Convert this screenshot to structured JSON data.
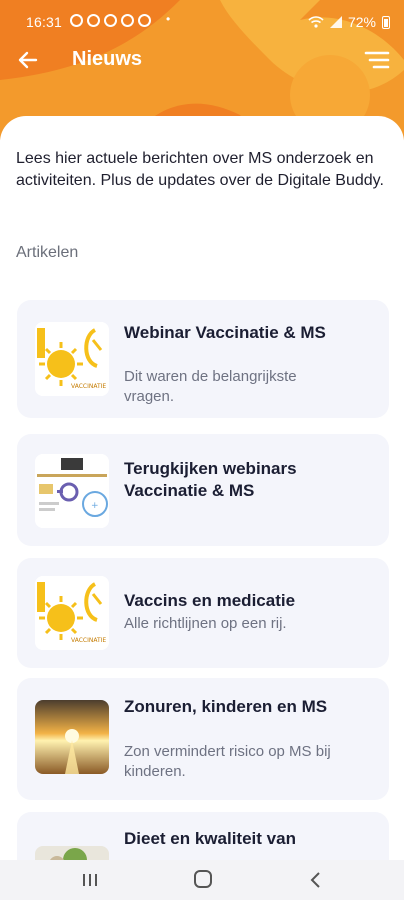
{
  "status_bar": {
    "time": "16:31",
    "battery": "72%"
  },
  "header": {
    "title": "Nieuws"
  },
  "intro_text": "Lees hier actuele berichten over MS onderzoek en activiteiten. Plus de updates over de Digitale Buddy.",
  "section_label": "Artikelen",
  "articles": [
    {
      "title": "Webinar Vaccinatie & MS",
      "subtitle": "Dit waren de belangrijkste vragen.",
      "thumb_text": "VACCINATIE"
    },
    {
      "title": "Terugkijken webinars Vaccinatie & MS",
      "subtitle": ""
    },
    {
      "title": "Vaccins en medicatie",
      "subtitle": "Alle richtlijnen op een rij.",
      "thumb_text": "VACCINATIE"
    },
    {
      "title": "Zonuren, kinderen en MS",
      "subtitle": "Zon vermindert risico op MS bij kinderen."
    },
    {
      "title": "Dieet en kwaliteit van",
      "subtitle": ""
    }
  ],
  "colors": {
    "header_orange": "#f39a2c",
    "card_bg": "#f4f5fb"
  },
  "icons": [
    "back-arrow-icon",
    "menu-icon",
    "wifi-icon",
    "battery-icon"
  ]
}
